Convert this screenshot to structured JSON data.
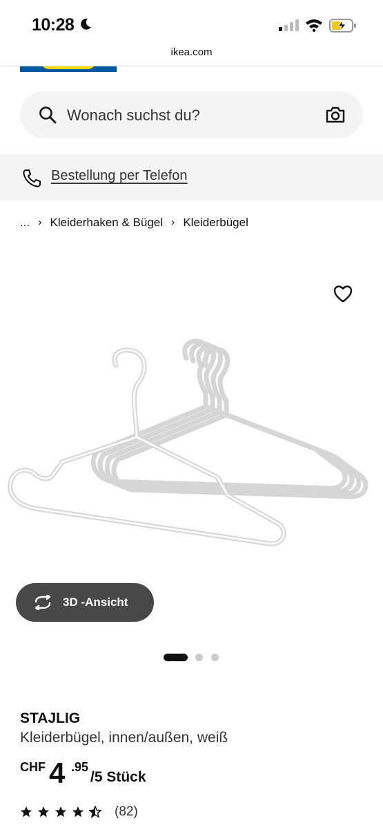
{
  "status_bar": {
    "time": "10:28",
    "icons": [
      "moon-icon",
      "signal-icon",
      "wifi-icon",
      "battery-charging-icon"
    ]
  },
  "browser": {
    "domain": "ikea.com"
  },
  "brand": {
    "logo": "ikea-logo",
    "colors": {
      "blue": "#0058a3",
      "yellow": "#ffdb00"
    }
  },
  "search": {
    "placeholder": "Wonach suchst du?",
    "icons": [
      "search-icon",
      "camera-icon"
    ]
  },
  "phone_banner": {
    "link_label": "Bestellung per Telefon",
    "icon": "phone-icon"
  },
  "breadcrumb": {
    "items": [
      "...",
      "Kleiderhaken & Bügel",
      "Kleiderbügel"
    ]
  },
  "gallery": {
    "view3d_label": "3D -Ansicht",
    "image_count": 3,
    "active_index": 0,
    "favorite_icon": "heart-icon"
  },
  "product": {
    "name": "STAJLIG",
    "description": "Kleiderbügel, innen/außen, weiß",
    "price": {
      "currency": "CHF",
      "integer": "4",
      "decimals": ".95",
      "unit": "/5 Stück"
    },
    "rating": {
      "stars": 4.5,
      "max_stars": 5,
      "review_count": "(82)"
    }
  }
}
